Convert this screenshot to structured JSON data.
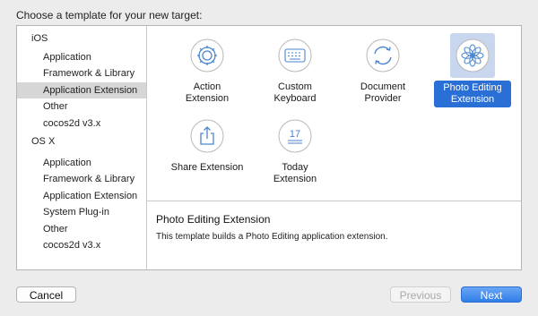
{
  "dialog": {
    "heading": "Choose a template for your new target:"
  },
  "sidebar": {
    "sections": [
      {
        "label": "iOS",
        "items": [
          "Application",
          "Framework & Library",
          "Application Extension",
          "Other",
          "cocos2d v3.x"
        ]
      },
      {
        "label": "OS X",
        "items": [
          "Application",
          "Framework & Library",
          "Application Extension",
          "System Plug-in",
          "Other",
          "cocos2d v3.x"
        ]
      }
    ],
    "selected": "Application Extension"
  },
  "templates": [
    {
      "label": "Action\nExtension",
      "icon": "gear-icon"
    },
    {
      "label": "Custom\nKeyboard",
      "icon": "keyboard-icon"
    },
    {
      "label": "Document\nProvider",
      "icon": "sync-icon"
    },
    {
      "label": "Photo Editing\nExtension",
      "icon": "photo-flower-icon",
      "selected": true
    },
    {
      "label": "Share Extension",
      "icon": "share-icon"
    },
    {
      "label": "Today\nExtension",
      "icon": "calendar-icon",
      "calendar_day": "17"
    }
  ],
  "description": {
    "title": "Photo Editing Extension",
    "text": "This template builds a Photo Editing application extension."
  },
  "buttons": {
    "cancel": "Cancel",
    "previous": "Previous",
    "next": "Next"
  },
  "colors": {
    "accent": "#2a6fd6",
    "icon_stroke": "#4a86cf",
    "selection_bg": "#c9d7ee"
  }
}
